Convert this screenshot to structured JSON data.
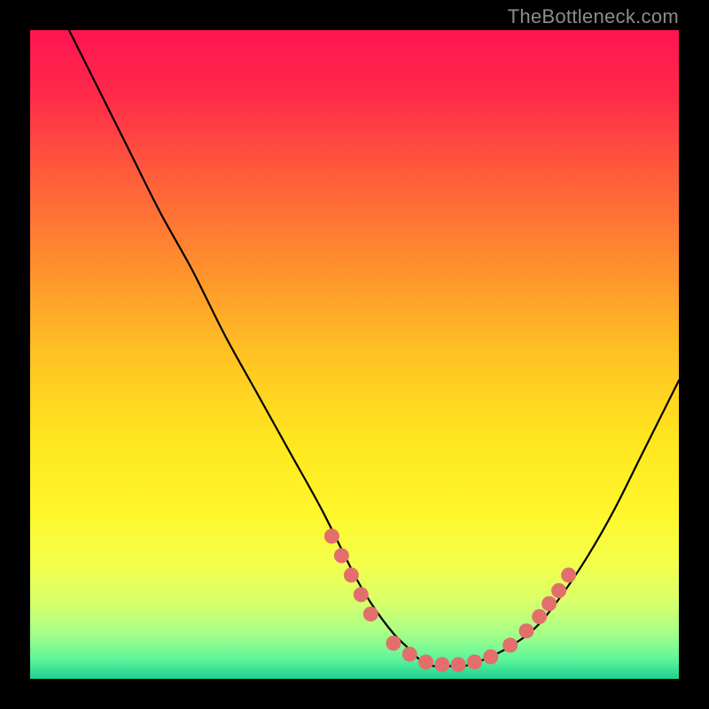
{
  "watermark": "TheBottleneck.com",
  "colors": {
    "marker": "#e36f6d",
    "curve": "#000000",
    "gradient_stops": [
      {
        "offset": 0.0,
        "color": "#ff1452"
      },
      {
        "offset": 0.1,
        "color": "#ff2a49"
      },
      {
        "offset": 0.22,
        "color": "#ff5b3b"
      },
      {
        "offset": 0.35,
        "color": "#ff8a2f"
      },
      {
        "offset": 0.5,
        "color": "#ffc223"
      },
      {
        "offset": 0.63,
        "color": "#ffe61f"
      },
      {
        "offset": 0.74,
        "color": "#fff62b"
      },
      {
        "offset": 0.82,
        "color": "#f4ff4a"
      },
      {
        "offset": 0.88,
        "color": "#d9ff6a"
      },
      {
        "offset": 0.93,
        "color": "#a6ff88"
      },
      {
        "offset": 0.97,
        "color": "#5cf59a"
      },
      {
        "offset": 1.0,
        "color": "#1bd18f"
      }
    ]
  },
  "chart_data": {
    "type": "line",
    "title": "",
    "xlabel": "",
    "ylabel": "",
    "xlim": [
      0,
      100
    ],
    "ylim": [
      0,
      100
    ],
    "series": [
      {
        "name": "bottleneck-curve",
        "x": [
          6,
          10,
          15,
          20,
          25,
          30,
          35,
          40,
          45,
          50,
          53,
          56,
          58,
          60,
          62,
          64,
          67,
          70,
          74,
          78,
          82,
          86,
          90,
          94,
          98,
          100
        ],
        "y": [
          100,
          92,
          82,
          72,
          63,
          53,
          44,
          35,
          26,
          16,
          11,
          7,
          5,
          3,
          2,
          2,
          2,
          3,
          5,
          8,
          13,
          19,
          26,
          34,
          42,
          46
        ]
      }
    ],
    "markers": {
      "name": "highlight-points",
      "x": [
        46.5,
        48,
        49.5,
        51,
        52.5,
        56,
        58.5,
        61,
        63.5,
        66,
        68.5,
        71,
        74,
        76.5,
        78.5,
        80,
        81.5,
        83
      ],
      "y": [
        22,
        19,
        16,
        13,
        10,
        5.5,
        3.8,
        2.6,
        2.2,
        2.2,
        2.6,
        3.4,
        5.2,
        7.4,
        9.6,
        11.6,
        13.6,
        16
      ]
    }
  }
}
